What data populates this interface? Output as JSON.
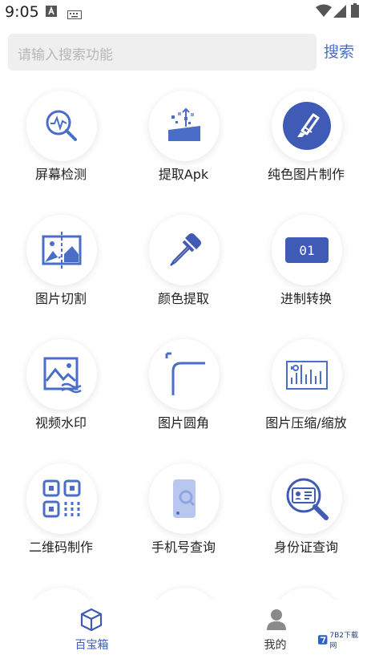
{
  "status_bar": {
    "time": "9:05"
  },
  "search": {
    "placeholder": "请输入搜索功能",
    "button_label": "搜索"
  },
  "tools": [
    {
      "label": "屏幕检测",
      "icon": "screen-check-icon"
    },
    {
      "label": "提取Apk",
      "icon": "extract-apk-icon"
    },
    {
      "label": "纯色图片制作",
      "icon": "brush-icon"
    },
    {
      "label": "图片切割",
      "icon": "image-split-icon"
    },
    {
      "label": "颜色提取",
      "icon": "eyedropper-icon"
    },
    {
      "label": "进制转换",
      "icon": "binary-convert-icon"
    },
    {
      "label": "视频水印",
      "icon": "video-watermark-icon"
    },
    {
      "label": "图片圆角",
      "icon": "rounded-corner-icon"
    },
    {
      "label": "图片压缩/缩放",
      "icon": "image-compress-icon"
    },
    {
      "label": "二维码制作",
      "icon": "qr-code-icon"
    },
    {
      "label": "手机号查询",
      "icon": "phone-search-icon"
    },
    {
      "label": "身份证查询",
      "icon": "id-card-search-icon"
    }
  ],
  "binary_badge_text": "01",
  "bottom_nav": {
    "tab_toolbox": "百宝箱",
    "tab_mine": "我的"
  },
  "watermark": {
    "text": "7B2下载网"
  },
  "colors": {
    "accent": "#4a6ec8",
    "active_tab": "#3f5bb6",
    "inactive_tab": "#333333"
  }
}
